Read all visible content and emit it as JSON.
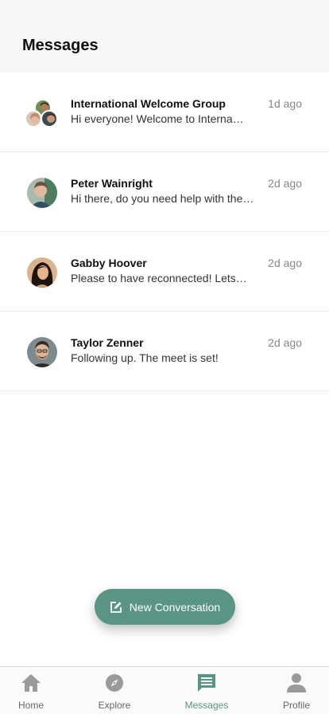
{
  "header": {
    "title": "Messages"
  },
  "conversations": [
    {
      "name": "International Welcome Group",
      "preview": "Hi everyone! Welcome to Interna…",
      "time": "1d ago",
      "avatar": "group-avatar"
    },
    {
      "name": "Peter Wainright",
      "preview": "Hi there, do you need help with the…",
      "time": "2d ago",
      "avatar": "peter-avatar"
    },
    {
      "name": "Gabby Hoover",
      "preview": "Please to have reconnected! Lets…",
      "time": "2d ago",
      "avatar": "gabby-avatar"
    },
    {
      "name": "Taylor Zenner",
      "preview": "Following up. The meet is set!",
      "time": "2d ago",
      "avatar": "taylor-avatar"
    }
  ],
  "fab": {
    "label": "New Conversation",
    "icon": "edit-icon"
  },
  "tabs": [
    {
      "label": "Home",
      "icon": "home-icon",
      "active": false
    },
    {
      "label": "Explore",
      "icon": "compass-icon",
      "active": false
    },
    {
      "label": "Messages",
      "icon": "message-icon",
      "active": true
    },
    {
      "label": "Profile",
      "icon": "person-icon",
      "active": false
    }
  ],
  "colors": {
    "accent": "#5a9484",
    "inactive": "#666666",
    "header_bg": "#f6f6f6"
  }
}
